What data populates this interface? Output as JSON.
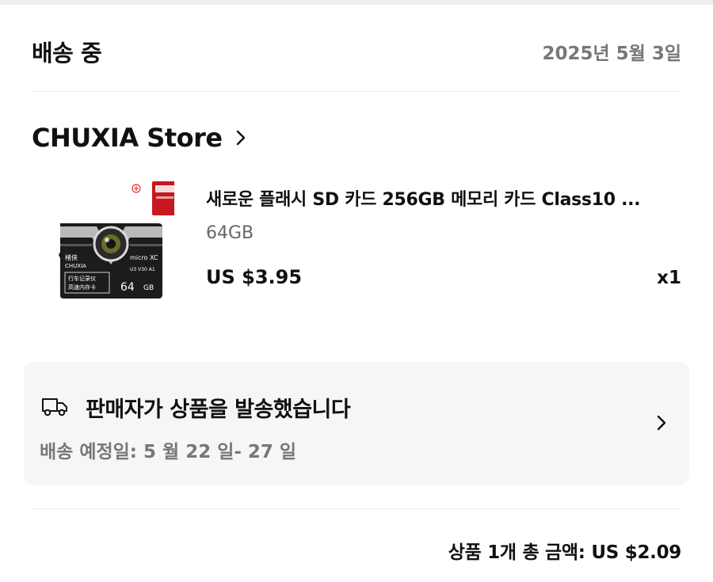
{
  "order": {
    "status": "배송 중",
    "date": "2025년 5월 3일"
  },
  "store": {
    "name": "CHUXIA Store",
    "chevron_icon": "chevron-right-icon"
  },
  "product": {
    "title": "새로운 플래시 SD 카드 256GB 메모리 카드 Class10 ...",
    "variant": "64GB",
    "price": "US $3.95",
    "quantity": "x1",
    "image": {
      "brand": "CHUXIA",
      "brand_cn": "楮侠",
      "capacity": "64",
      "unit": "GB",
      "label_line1": "行车记录仪",
      "label_line2": "高速内存卡",
      "speed_text": "U3 V30 A1",
      "card_logo": "micro XC"
    }
  },
  "shipping": {
    "icon": "truck-icon",
    "status": "판매자가 상품을 발송했습니다",
    "eta": "배송 예정일: 5 월 22 일- 27 일",
    "chevron_icon": "chevron-right-icon"
  },
  "summary": {
    "total_text": "상품 1개 총 금액: US $2.09"
  },
  "colors": {
    "text_primary": "#111111",
    "text_secondary": "#777777",
    "card_background": "#f6f6f6",
    "divider": "#ececec"
  }
}
